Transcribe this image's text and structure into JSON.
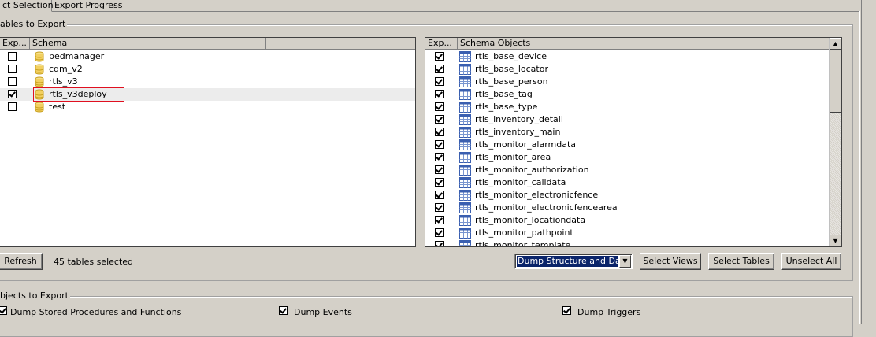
{
  "tabs": [
    {
      "label": "ct Selection",
      "active": true
    },
    {
      "label": "Export Progress",
      "active": false
    }
  ],
  "tables_group": {
    "title": "ables to Export"
  },
  "schema_table": {
    "headers": [
      "Exp...",
      "Schema"
    ],
    "rows": [
      {
        "checked": false,
        "name": "bedmanager"
      },
      {
        "checked": false,
        "name": "cqm_v2"
      },
      {
        "checked": false,
        "name": "rtls_v3"
      },
      {
        "checked": true,
        "name": "rtls_v3deploy",
        "selected": true
      },
      {
        "checked": false,
        "name": "test"
      }
    ]
  },
  "objects_table": {
    "headers": [
      "Exp...",
      "Schema Objects"
    ],
    "rows": [
      {
        "checked": true,
        "name": "rtls_base_device"
      },
      {
        "checked": true,
        "name": "rtls_base_locator"
      },
      {
        "checked": true,
        "name": "rtls_base_person"
      },
      {
        "checked": true,
        "name": "rtls_base_tag"
      },
      {
        "checked": true,
        "name": "rtls_base_type"
      },
      {
        "checked": true,
        "name": "rtls_inventory_detail"
      },
      {
        "checked": true,
        "name": "rtls_inventory_main"
      },
      {
        "checked": true,
        "name": "rtls_monitor_alarmdata"
      },
      {
        "checked": true,
        "name": "rtls_monitor_area"
      },
      {
        "checked": true,
        "name": "rtls_monitor_authorization"
      },
      {
        "checked": true,
        "name": "rtls_monitor_calldata"
      },
      {
        "checked": true,
        "name": "rtls_monitor_electronicfence"
      },
      {
        "checked": true,
        "name": "rtls_monitor_electronicfencearea"
      },
      {
        "checked": true,
        "name": "rtls_monitor_locationdata"
      },
      {
        "checked": true,
        "name": "rtls_monitor_pathpoint"
      },
      {
        "checked": true,
        "name": "rtls_monitor_template"
      }
    ]
  },
  "toolbar": {
    "refresh_label": "Refresh",
    "status_text": "45 tables selected",
    "dump_select_value": "Dump Structure and Dat",
    "select_views_label": "Select Views",
    "select_tables_label": "Select Tables",
    "unselect_all_label": "Unselect All"
  },
  "objects_group": {
    "title": "bjects to Export",
    "options": [
      {
        "label": "Dump Stored Procedures and Functions",
        "checked": true
      },
      {
        "label": "Dump Events",
        "checked": true
      },
      {
        "label": "Dump Triggers",
        "checked": true
      }
    ]
  },
  "colors": {
    "window_bg": "#d4d0c8",
    "selection_highlight": "#0a246a",
    "annotation_box": "#e01020"
  }
}
